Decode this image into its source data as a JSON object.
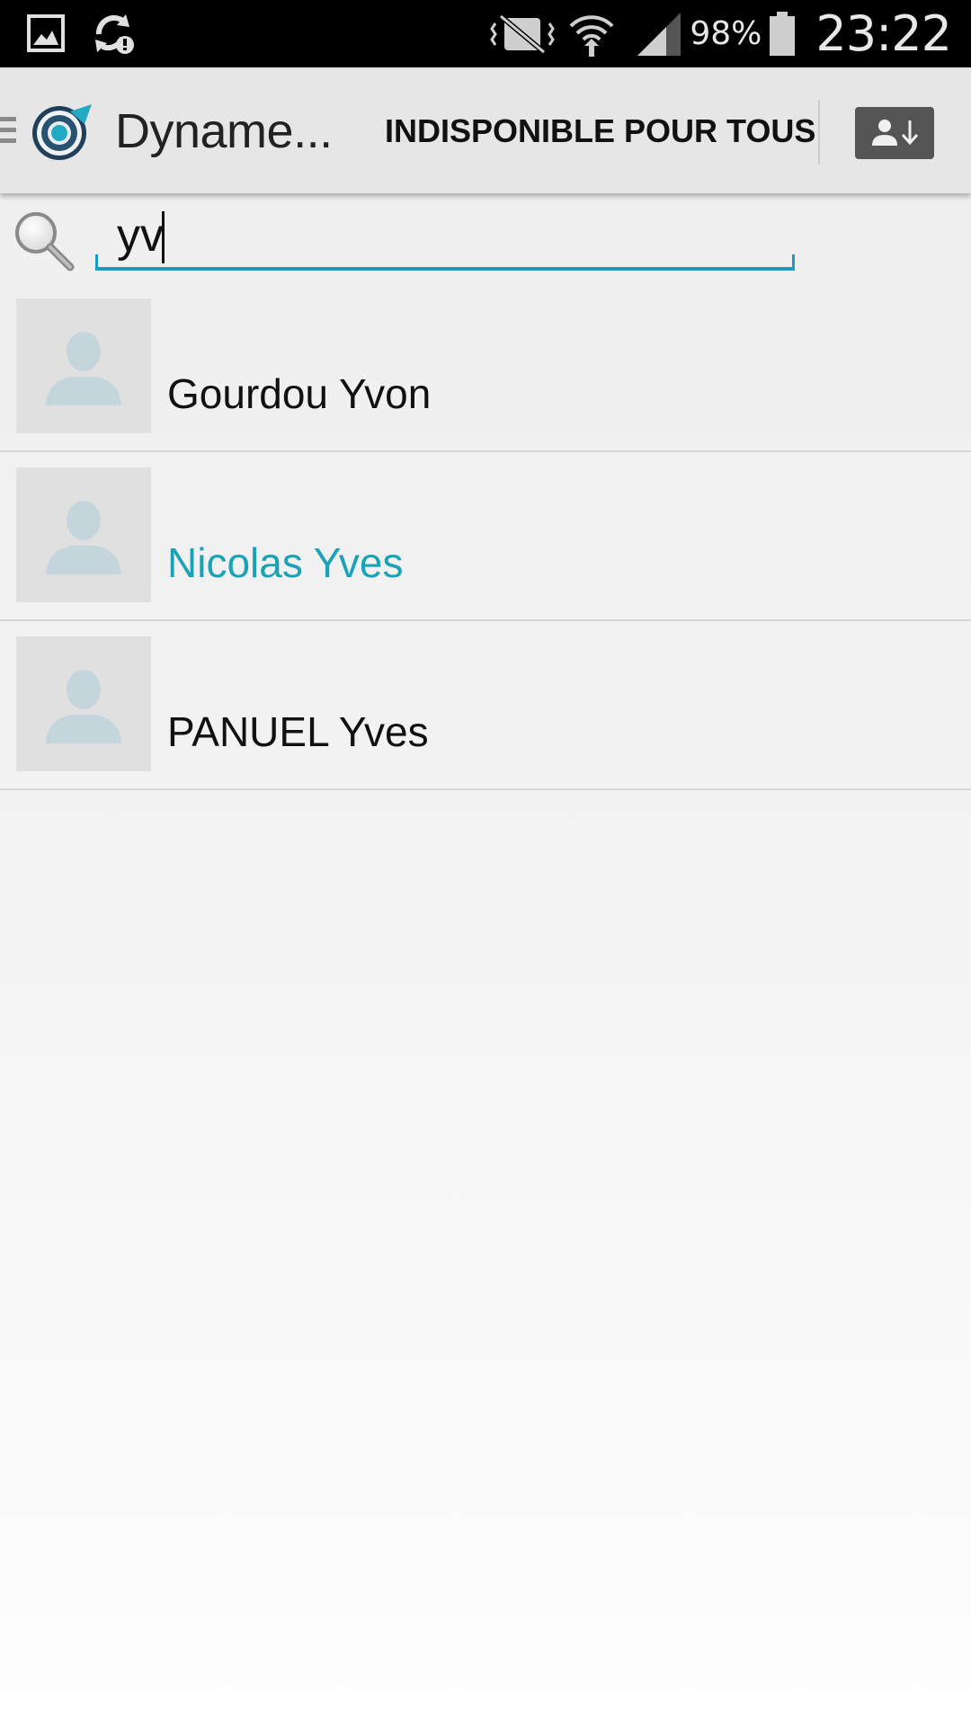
{
  "status_bar": {
    "battery": "98%",
    "time": "23:22",
    "icons": [
      "gallery-icon",
      "sync-alert-icon",
      "vibrate-mute-icon",
      "wifi-icon",
      "signal-icon",
      "battery-icon"
    ]
  },
  "action_bar": {
    "title": "Dyname...",
    "action_label": "INDISPONIBLE POUR TOUS",
    "icons": [
      "drawer-icon",
      "app-logo",
      "contact-download-icon"
    ]
  },
  "search": {
    "value": "yv",
    "placeholder": ""
  },
  "contacts": [
    {
      "name": "Gourdou Yvon",
      "highlighted": false
    },
    {
      "name": "Nicolas Yves",
      "highlighted": true
    },
    {
      "name": "PANUEL Yves",
      "highlighted": false
    }
  ],
  "colors": {
    "accent": "#1aa3b6",
    "search_underline": "#1a9ac4",
    "action_bar": "#e6e6e6",
    "status_bar": "#000000"
  }
}
